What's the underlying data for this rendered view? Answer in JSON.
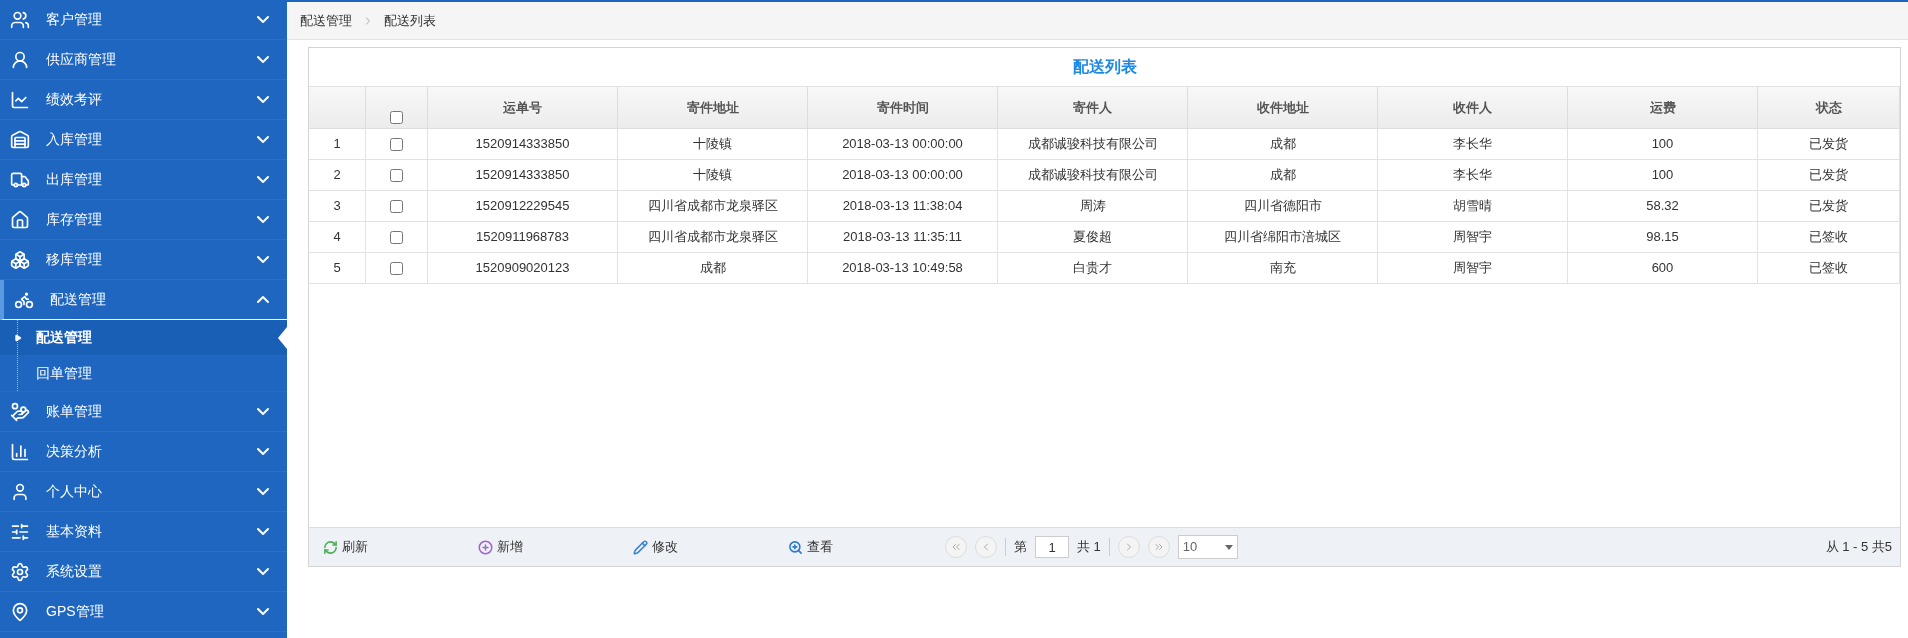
{
  "sidebar": {
    "items": [
      {
        "label": "客户管理",
        "expanded": false
      },
      {
        "label": "供应商管理",
        "expanded": false
      },
      {
        "label": "绩效考评",
        "expanded": false
      },
      {
        "label": "入库管理",
        "expanded": false
      },
      {
        "label": "出库管理",
        "expanded": false
      },
      {
        "label": "库存管理",
        "expanded": false
      },
      {
        "label": "移库管理",
        "expanded": false
      },
      {
        "label": "配送管理",
        "expanded": true,
        "children": [
          {
            "label": "配送管理",
            "selected": true
          },
          {
            "label": "回单管理",
            "selected": false
          }
        ]
      },
      {
        "label": "账单管理",
        "expanded": false
      },
      {
        "label": "决策分析",
        "expanded": false
      },
      {
        "label": "个人中心",
        "expanded": false
      },
      {
        "label": "基本资料",
        "expanded": false
      },
      {
        "label": "系统设置",
        "expanded": false
      },
      {
        "label": "GPS管理",
        "expanded": false
      }
    ]
  },
  "breadcrumb": [
    "配送管理",
    "配送列表"
  ],
  "table": {
    "title": "配送列表",
    "columns": [
      "运单号",
      "寄件地址",
      "寄件时间",
      "寄件人",
      "收件地址",
      "收件人",
      "运费",
      "状态"
    ],
    "header_checked": false,
    "rows": [
      {
        "index": "1",
        "checked": false,
        "cells": [
          "1520914333850",
          "十陵镇",
          "2018-03-13 00:00:00",
          "成都诚骏科技有限公司",
          "成都",
          "李长华",
          "100",
          "已发货"
        ]
      },
      {
        "index": "2",
        "checked": false,
        "cells": [
          "1520914333850",
          "十陵镇",
          "2018-03-13 00:00:00",
          "成都诚骏科技有限公司",
          "成都",
          "李长华",
          "100",
          "已发货"
        ]
      },
      {
        "index": "3",
        "checked": false,
        "cells": [
          "1520912229545",
          "四川省成都市龙泉驿区",
          "2018-03-13 11:38:04",
          "周涛",
          "四川省德阳市",
          "胡雪晴",
          "58.32",
          "已发货"
        ]
      },
      {
        "index": "4",
        "checked": false,
        "cells": [
          "1520911968783",
          "四川省成都市龙泉驿区",
          "2018-03-13 11:35:11",
          "夏俊超",
          "四川省绵阳市涪城区",
          "周智宇",
          "98.15",
          "已签收"
        ]
      },
      {
        "index": "5",
        "checked": false,
        "cells": [
          "1520909020123",
          "成都",
          "2018-03-13 10:49:58",
          "白贵才",
          "南充",
          "周智宇",
          "600",
          "已签收"
        ]
      }
    ]
  },
  "toolbar": [
    {
      "kind": "refresh",
      "label": "刷新"
    },
    {
      "kind": "add",
      "label": "新增"
    },
    {
      "kind": "edit",
      "label": "修改"
    },
    {
      "kind": "view",
      "label": "查看"
    }
  ],
  "pager": {
    "page_prefix": "第",
    "page": "1",
    "total_pages": "共 1",
    "page_size": "10",
    "summary": "从 1 - 5 共5"
  }
}
